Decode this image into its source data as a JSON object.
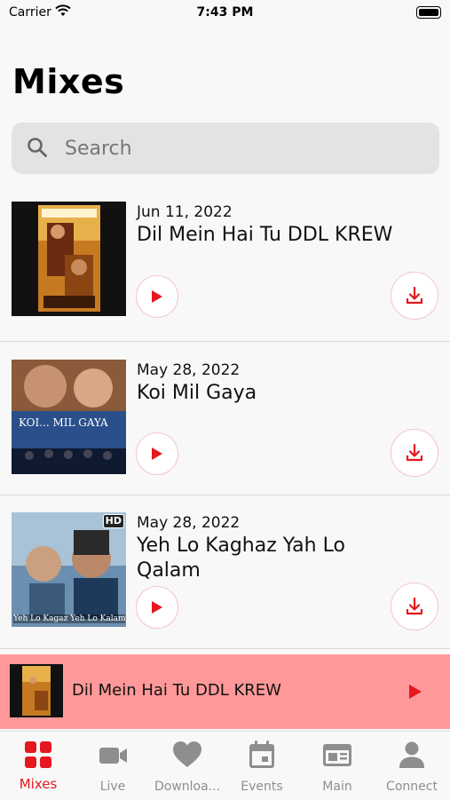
{
  "status": {
    "carrier": "Carrier",
    "time": "7:43 PM"
  },
  "header": {
    "title": "Mixes"
  },
  "search": {
    "placeholder": "Search"
  },
  "mixes": [
    {
      "date": "Jun 11, 2022",
      "title": "Dil Mein Hai Tu DDL KREW"
    },
    {
      "date": "May 28, 2022",
      "title": "Koi Mil Gaya",
      "poster_text": "KOI... MIL GAYA"
    },
    {
      "date": "May 28, 2022",
      "title": "Yeh Lo Kaghaz Yah Lo Qalam",
      "poster_caption": "Yeh Lo Kagaz Yeh Lo Kalam...",
      "badge": "HD"
    }
  ],
  "mini_player": {
    "title": "Dil Mein Hai Tu DDL KREW"
  },
  "tabs": [
    {
      "label": "Mixes",
      "icon": "grid-icon",
      "active": true
    },
    {
      "label": "Live",
      "icon": "video-camera-icon"
    },
    {
      "label": "Downloa...",
      "icon": "heart-icon"
    },
    {
      "label": "Events",
      "icon": "calendar-icon"
    },
    {
      "label": "Main",
      "icon": "browser-window-icon"
    },
    {
      "label": "Connect",
      "icon": "person-icon"
    }
  ],
  "colors": {
    "accent": "#e5171f",
    "mini_player_bg": "#ff9999",
    "search_bg": "#e3e3e3",
    "inactive_tab": "#8e8e8e"
  }
}
